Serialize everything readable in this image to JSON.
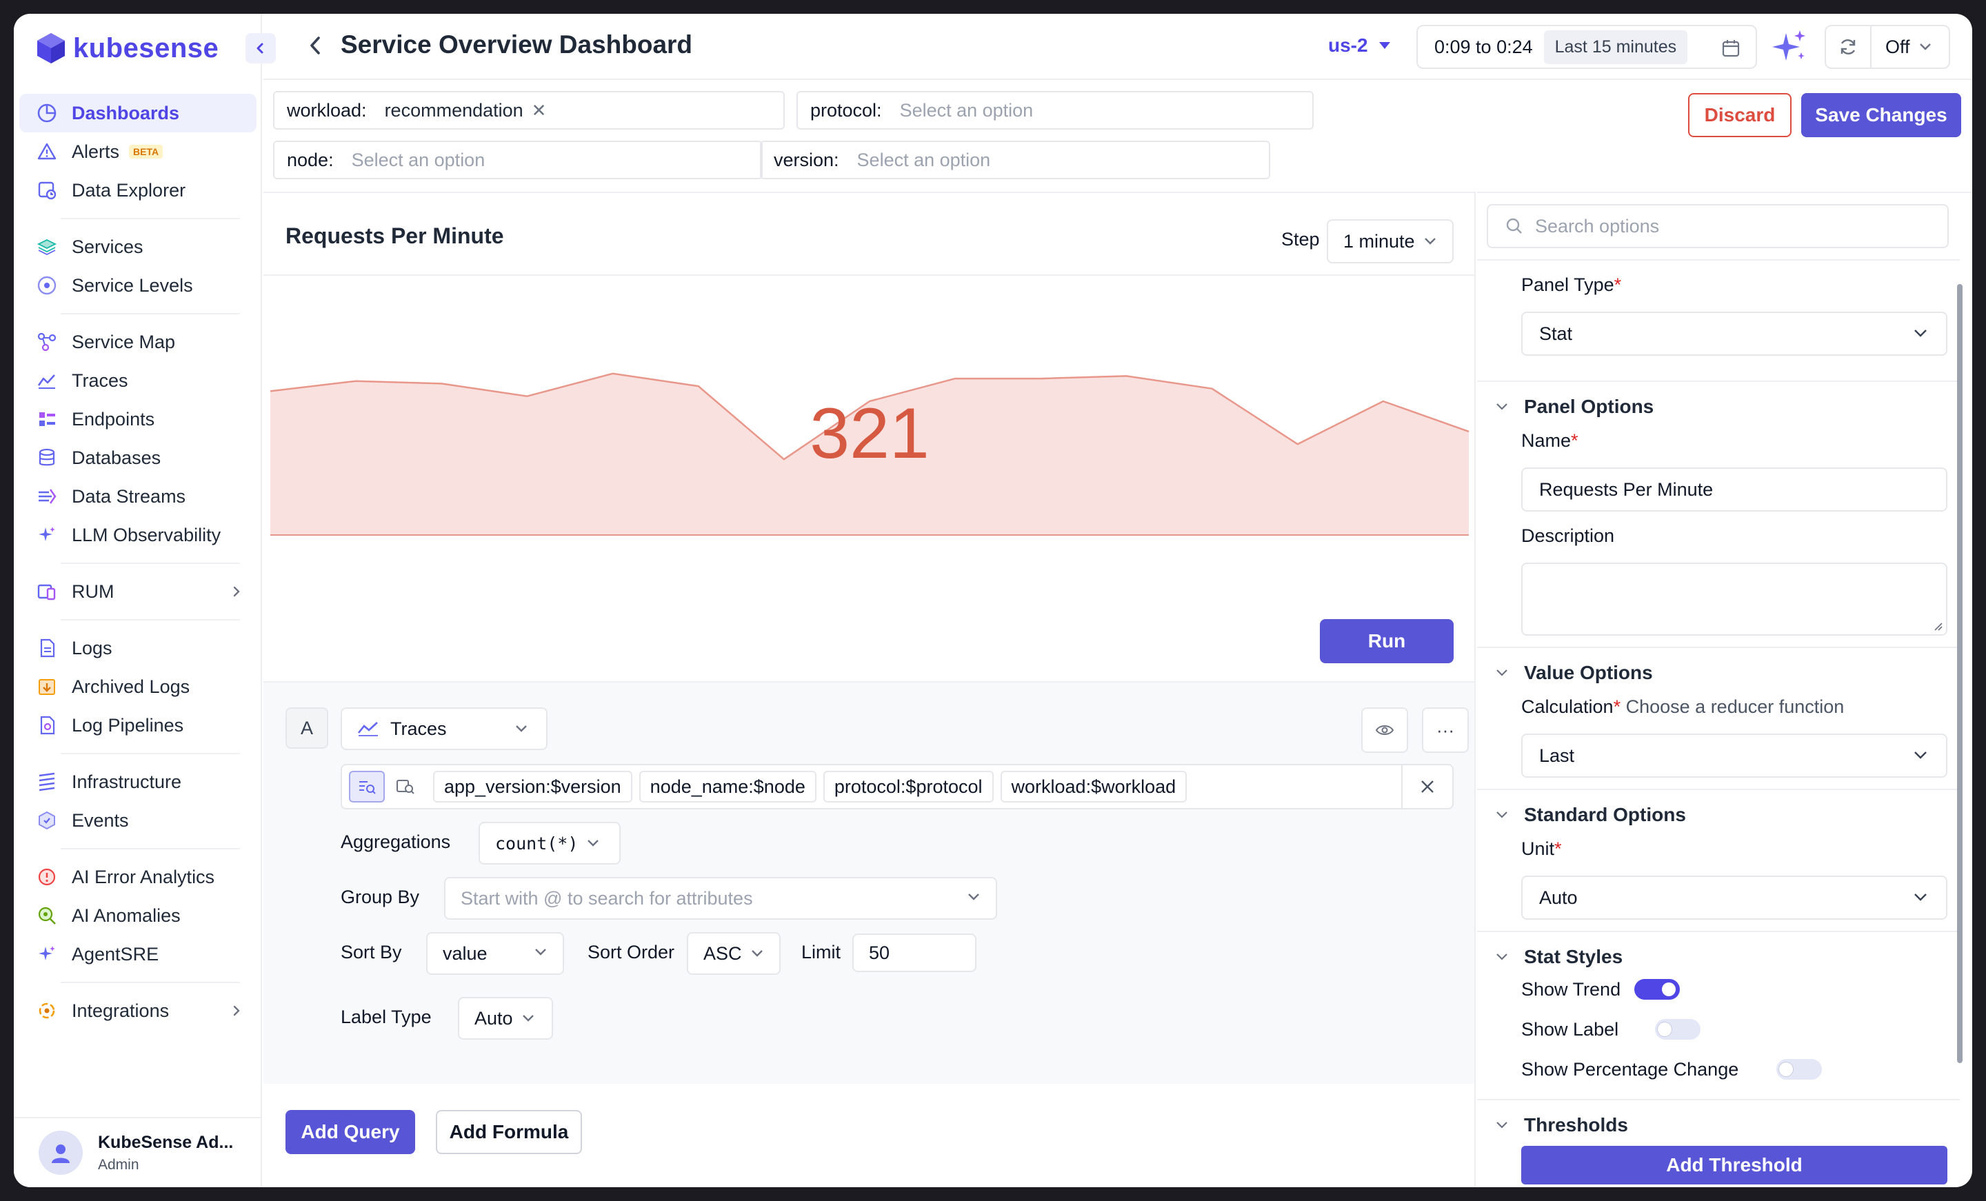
{
  "brand": {
    "name": "kubesense"
  },
  "sidebar": {
    "items": [
      {
        "label": "Dashboards",
        "icon": "dashboard-icon",
        "active": true
      },
      {
        "label": "Alerts",
        "icon": "alert-icon",
        "badge": "BETA"
      },
      {
        "label": "Data Explorer",
        "icon": "data-explorer-icon"
      },
      {
        "label": "Services",
        "icon": "services-icon"
      },
      {
        "label": "Service Levels",
        "icon": "service-levels-icon"
      },
      {
        "label": "Service Map",
        "icon": "service-map-icon"
      },
      {
        "label": "Traces",
        "icon": "traces-icon"
      },
      {
        "label": "Endpoints",
        "icon": "endpoints-icon"
      },
      {
        "label": "Databases",
        "icon": "database-icon"
      },
      {
        "label": "Data Streams",
        "icon": "data-streams-icon"
      },
      {
        "label": "LLM Observability",
        "icon": "sparkle-icon"
      },
      {
        "label": "RUM",
        "icon": "rum-icon",
        "expandable": true
      },
      {
        "label": "Logs",
        "icon": "logs-icon"
      },
      {
        "label": "Archived Logs",
        "icon": "archive-icon"
      },
      {
        "label": "Log Pipelines",
        "icon": "pipeline-icon"
      },
      {
        "label": "Infrastructure",
        "icon": "infrastructure-icon"
      },
      {
        "label": "Events",
        "icon": "events-icon"
      },
      {
        "label": "AI Error Analytics",
        "icon": "error-icon"
      },
      {
        "label": "AI Anomalies",
        "icon": "anomaly-icon"
      },
      {
        "label": "AgentSRE",
        "icon": "sparkle-icon"
      },
      {
        "label": "Integrations",
        "icon": "integrations-icon",
        "expandable": true
      }
    ],
    "profile": {
      "name": "KubeSense Ad...",
      "role": "Admin"
    }
  },
  "header": {
    "title": "Service Overview Dashboard",
    "region": "us-2",
    "time_range": "0:09 to 0:24",
    "time_preset": "Last 15 minutes",
    "refresh": "Off"
  },
  "filters": {
    "workload": {
      "label": "workload:",
      "value": "recommendation"
    },
    "protocol": {
      "label": "protocol:",
      "placeholder": "Select an option"
    },
    "node": {
      "label": "node:",
      "placeholder": "Select an option"
    },
    "version": {
      "label": "version:",
      "placeholder": "Select an option"
    }
  },
  "actions": {
    "discard": "Discard",
    "save": "Save Changes"
  },
  "panel": {
    "title": "Requests Per Minute",
    "step_label": "Step",
    "step_value": "1 minute",
    "stat_value": "321",
    "run_label": "Run",
    "colors": {
      "stat": "#d65a42",
      "fill": "#f9e1df",
      "line": "#e8978a",
      "accent": "#5856d6"
    }
  },
  "chart_data": {
    "type": "area",
    "values": [
      57,
      61,
      60,
      55,
      64,
      59,
      30,
      53,
      62,
      62,
      63,
      58,
      36,
      53,
      41
    ],
    "ylim": [
      0,
      100
    ],
    "grid": false,
    "legend": "none"
  },
  "query": {
    "letter": "A",
    "source": "Traces",
    "chips": [
      "app_version:$version",
      "node_name:$node",
      "protocol:$protocol",
      "workload:$workload"
    ],
    "aggregations_label": "Aggregations",
    "aggregation_value": "count(*)",
    "group_by_label": "Group By",
    "group_by_placeholder": "Start with @ to search for attributes",
    "sort_by_label": "Sort By",
    "sort_by_value": "value",
    "sort_order_label": "Sort Order",
    "sort_order_value": "ASC",
    "limit_label": "Limit",
    "limit_value": "50",
    "label_type_label": "Label Type",
    "label_type_value": "Auto",
    "more_label": "···"
  },
  "bottom": {
    "add_query": "Add Query",
    "add_formula": "Add Formula"
  },
  "options": {
    "search_placeholder": "Search options",
    "panel_type_label": "Panel Type",
    "panel_type_value": "Stat",
    "panel_options_heading": "Panel Options",
    "name_label": "Name",
    "name_value": "Requests Per Minute",
    "description_label": "Description",
    "value_options_heading": "Value Options",
    "calculation_label": "Calculation",
    "calculation_hint": "Choose a reducer function",
    "calculation_value": "Last",
    "standard_options_heading": "Standard Options",
    "unit_label": "Unit",
    "unit_value": "Auto",
    "stat_styles_heading": "Stat Styles",
    "show_trend": "Show Trend",
    "show_label": "Show Label",
    "show_percentage_change": "Show Percentage Change",
    "thresholds_heading": "Thresholds",
    "add_threshold": "Add Threshold",
    "toggles": {
      "show_trend": true,
      "show_label": false,
      "show_percentage_change": false
    }
  }
}
